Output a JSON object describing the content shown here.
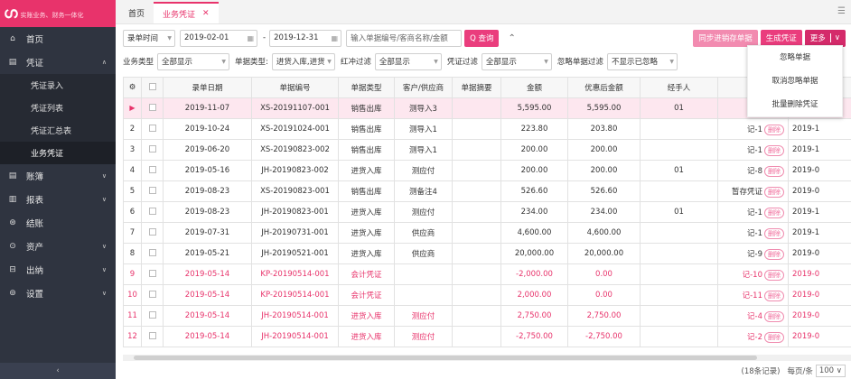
{
  "app": {
    "logo_mark": "ഗ",
    "slogan": "实账业务、财务一体化"
  },
  "sidebar": {
    "items": [
      {
        "icon": "⌂",
        "label": "首页",
        "chevron": ""
      },
      {
        "icon": "▤",
        "label": "凭证",
        "chevron": "∧"
      },
      {
        "icon": "▤",
        "label": "账簿",
        "chevron": "∨"
      },
      {
        "icon": "▥",
        "label": "报表",
        "chevron": "∨"
      },
      {
        "icon": "⊛",
        "label": "结账",
        "chevron": ""
      },
      {
        "icon": "⊙",
        "label": "资产",
        "chevron": "∨"
      },
      {
        "icon": "⊟",
        "label": "出纳",
        "chevron": "∨"
      },
      {
        "icon": "⊚",
        "label": "设置",
        "chevron": "∨"
      }
    ],
    "sub_items": [
      "凭证录入",
      "凭证列表",
      "凭证汇总表",
      "业务凭证"
    ],
    "collapse_icon": "‹"
  },
  "tabs": {
    "home": "首页",
    "active": "业务凭证",
    "close": "✕",
    "menu": "☰"
  },
  "filters": {
    "date_type": "录单时间",
    "date_from": "2019-02-01",
    "date_to": "2019-12-31",
    "date_sep": "-",
    "search_placeholder": "输入单据编号/客商名称/金额",
    "search_button": "Q 查询",
    "collapse": "⌃",
    "sync_button": "同步进销存单据",
    "generate_button": "生成凭证",
    "more_button": "更多",
    "biz_type_label": "业务类型",
    "biz_type_value": "全部显示",
    "doc_type_label": "单据类型:",
    "doc_type_value": "进货入库,进货",
    "redflush_label": "红冲过滤",
    "redflush_value": "全部显示",
    "voucher_label": "凭证过滤",
    "voucher_value": "全部显示",
    "ignore_label": "忽略单据过滤",
    "ignore_value": "不显示已忽略"
  },
  "dropdown": [
    "忽略单据",
    "取消忽略单据",
    "批量删除凭证"
  ],
  "table": {
    "headers": [
      "⚙",
      "",
      "录单日期",
      "单据编号",
      "单据类型",
      "客户/供应商",
      "单据摘要",
      "金额",
      "优惠后金额",
      "经手人",
      "",
      ""
    ],
    "rows": [
      {
        "idx": "▶",
        "date": "2019-11-07",
        "no": "XS-20191107-001",
        "type": "销售出库",
        "party": "测导入3",
        "memo": "",
        "amount": "5,595.00",
        "net": "5,595.00",
        "handler": "01",
        "voucher": "",
        "extra": "",
        "style": "sel-row"
      },
      {
        "idx": "2",
        "date": "2019-10-24",
        "no": "XS-20191024-001",
        "type": "销售出库",
        "party": "测导入1",
        "memo": "",
        "amount": "223.80",
        "net": "203.80",
        "handler": "",
        "voucher": "记-1",
        "extra": "2019-1",
        "style": ""
      },
      {
        "idx": "3",
        "date": "2019-06-20",
        "no": "XS-20190823-002",
        "type": "销售出库",
        "party": "测导入1",
        "memo": "",
        "amount": "200.00",
        "net": "200.00",
        "handler": "",
        "voucher": "记-1",
        "extra": "2019-1",
        "style": ""
      },
      {
        "idx": "4",
        "date": "2019-05-16",
        "no": "JH-20190823-002",
        "type": "进货入库",
        "party": "测应付",
        "memo": "",
        "amount": "200.00",
        "net": "200.00",
        "handler": "01",
        "voucher": "记-8",
        "extra": "2019-0",
        "style": ""
      },
      {
        "idx": "5",
        "date": "2019-08-23",
        "no": "XS-20190823-001",
        "type": "销售出库",
        "party": "测备注4",
        "memo": "",
        "amount": "526.60",
        "net": "526.60",
        "handler": "",
        "voucher": "暂存凭证",
        "extra": "2019-0",
        "style": ""
      },
      {
        "idx": "6",
        "date": "2019-08-23",
        "no": "JH-20190823-001",
        "type": "进货入库",
        "party": "测应付",
        "memo": "",
        "amount": "234.00",
        "net": "234.00",
        "handler": "01",
        "voucher": "记-1",
        "extra": "2019-1",
        "style": ""
      },
      {
        "idx": "7",
        "date": "2019-07-31",
        "no": "JH-20190731-001",
        "type": "进货入库",
        "party": "供应商",
        "memo": "",
        "amount": "4,600.00",
        "net": "4,600.00",
        "handler": "",
        "voucher": "记-1",
        "extra": "2019-1",
        "style": ""
      },
      {
        "idx": "8",
        "date": "2019-05-21",
        "no": "JH-20190521-001",
        "type": "进货入库",
        "party": "供应商",
        "memo": "",
        "amount": "20,000.00",
        "net": "20,000.00",
        "handler": "",
        "voucher": "记-9",
        "extra": "2019-0",
        "style": ""
      },
      {
        "idx": "9",
        "date": "2019-05-14",
        "no": "KP-20190514-001",
        "type": "会计凭证",
        "party": "",
        "memo": "",
        "amount": "-2,000.00",
        "net": "0.00",
        "handler": "",
        "voucher": "记-10",
        "extra": "2019-0",
        "style": "red"
      },
      {
        "idx": "10",
        "date": "2019-05-14",
        "no": "KP-20190514-001",
        "type": "会计凭证",
        "party": "",
        "memo": "",
        "amount": "2,000.00",
        "net": "0.00",
        "handler": "",
        "voucher": "记-11",
        "extra": "2019-0",
        "style": "red"
      },
      {
        "idx": "11",
        "date": "2019-05-14",
        "no": "JH-20190514-001",
        "type": "进货入库",
        "party": "测应付",
        "memo": "",
        "amount": "2,750.00",
        "net": "2,750.00",
        "handler": "",
        "voucher": "记-4",
        "extra": "2019-0",
        "style": "red"
      },
      {
        "idx": "12",
        "date": "2019-05-14",
        "no": "JH-20190514-001",
        "type": "进货入库",
        "party": "测应付",
        "memo": "",
        "amount": "-2,750.00",
        "net": "-2,750.00",
        "handler": "",
        "voucher": "记-2",
        "extra": "2019-0",
        "style": "red"
      }
    ],
    "delete_label": "删除"
  },
  "footer": {
    "total": "(18条记录)",
    "per_page_label": "每页/条",
    "per_page": "100 ∨"
  }
}
